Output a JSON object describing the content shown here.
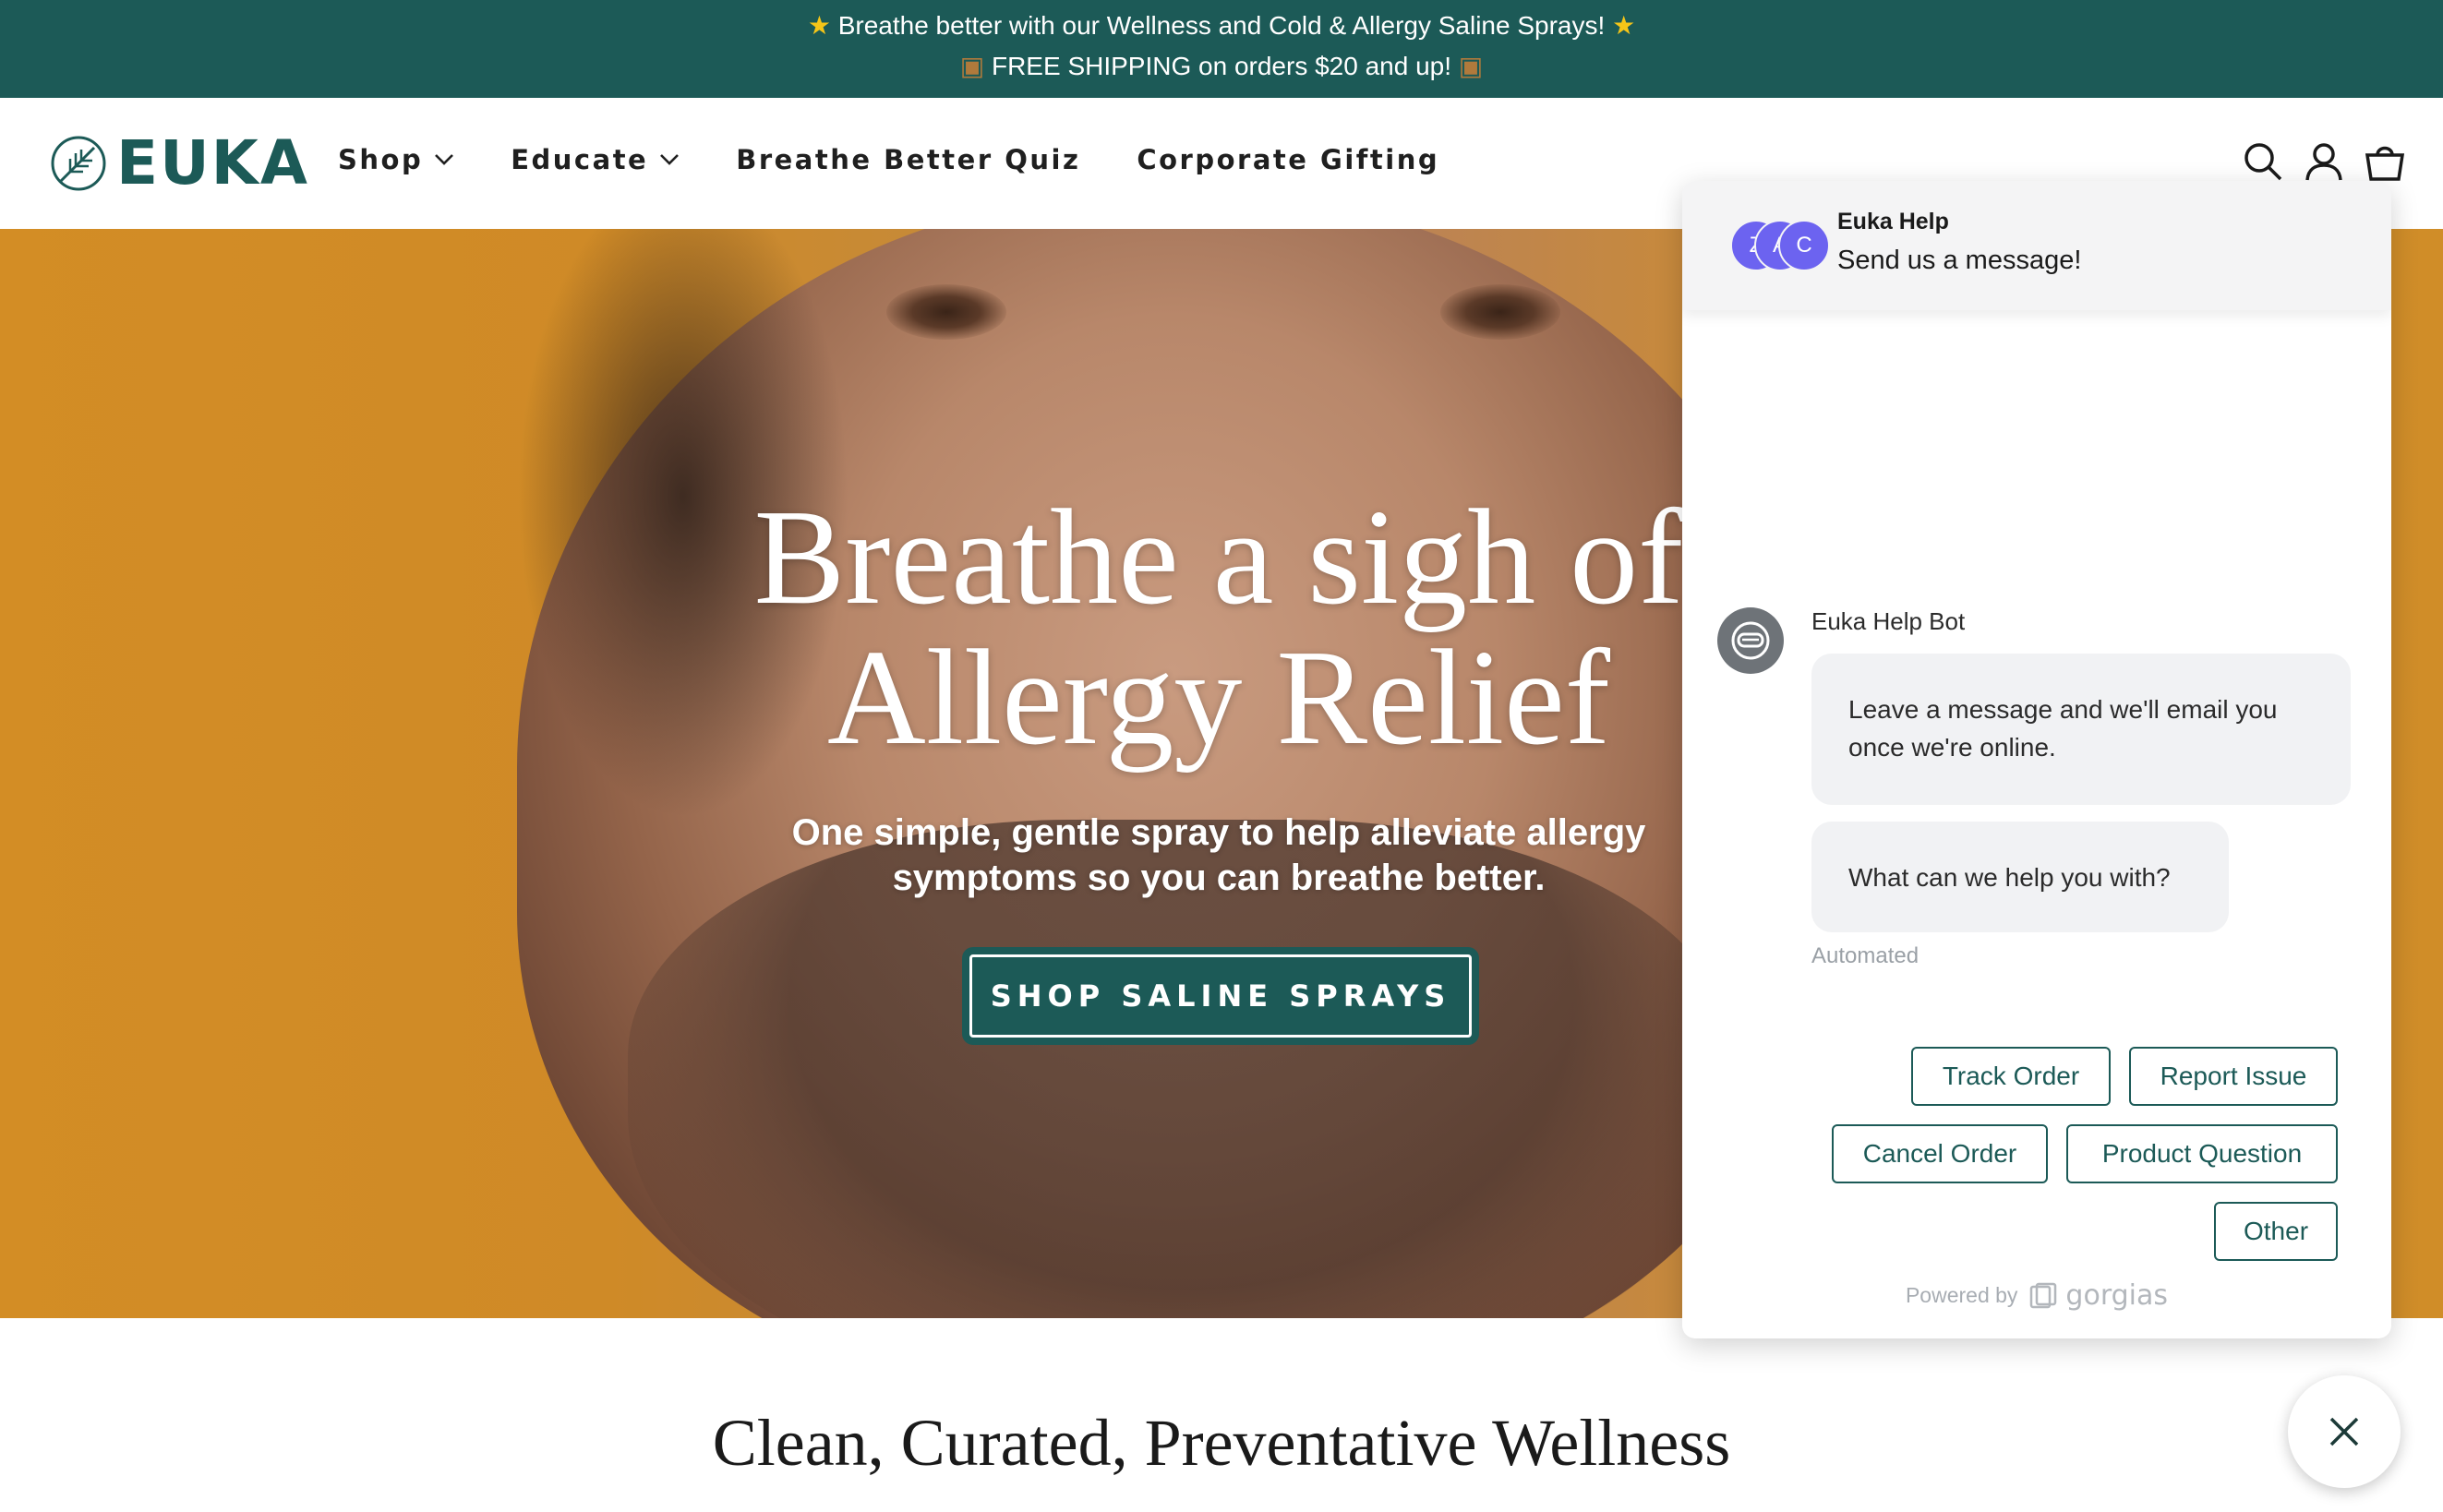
{
  "announcement": {
    "line1": "Breathe better with our Wellness and Cold & Allergy Saline Sprays!",
    "line2": "FREE SHIPPING on orders $20 and up!"
  },
  "header": {
    "logo_text": "EUKA",
    "nav": [
      {
        "label": "Shop",
        "dropdown": true
      },
      {
        "label": "Educate",
        "dropdown": true
      },
      {
        "label": "Breathe Better Quiz",
        "dropdown": false
      },
      {
        "label": "Corporate Gifting",
        "dropdown": false
      }
    ],
    "icons": [
      "search-icon",
      "account-icon",
      "cart-icon"
    ]
  },
  "hero": {
    "title_line1": "Breathe a sigh of",
    "title_line2": "Allergy Relief",
    "subtitle_line1": "One simple, gentle spray to help alleviate allergy",
    "subtitle_line2": "symptoms so you can breathe better.",
    "cta": "SHOP SALINE SPRAYS"
  },
  "section": {
    "title": "Clean, Curated, Preventative Wellness"
  },
  "chat": {
    "header_name": "Euka Help",
    "header_sub": "Send us a message!",
    "avatars": [
      "Z",
      "A",
      "C"
    ],
    "bot_name": "Euka Help Bot",
    "message1": "Leave a message and we'll email you once we're online.",
    "message2": "What can we help you with?",
    "automated": "Automated",
    "quick_replies": [
      "Track Order",
      "Report Issue",
      "Cancel Order",
      "Product Question",
      "Other"
    ],
    "powered_by": "Powered by",
    "powered_brand": "gorgias"
  },
  "colors": {
    "brand_teal": "#1c5a57",
    "hero_orange": "#d08d28",
    "chat_avatar": "#6c63f0"
  }
}
